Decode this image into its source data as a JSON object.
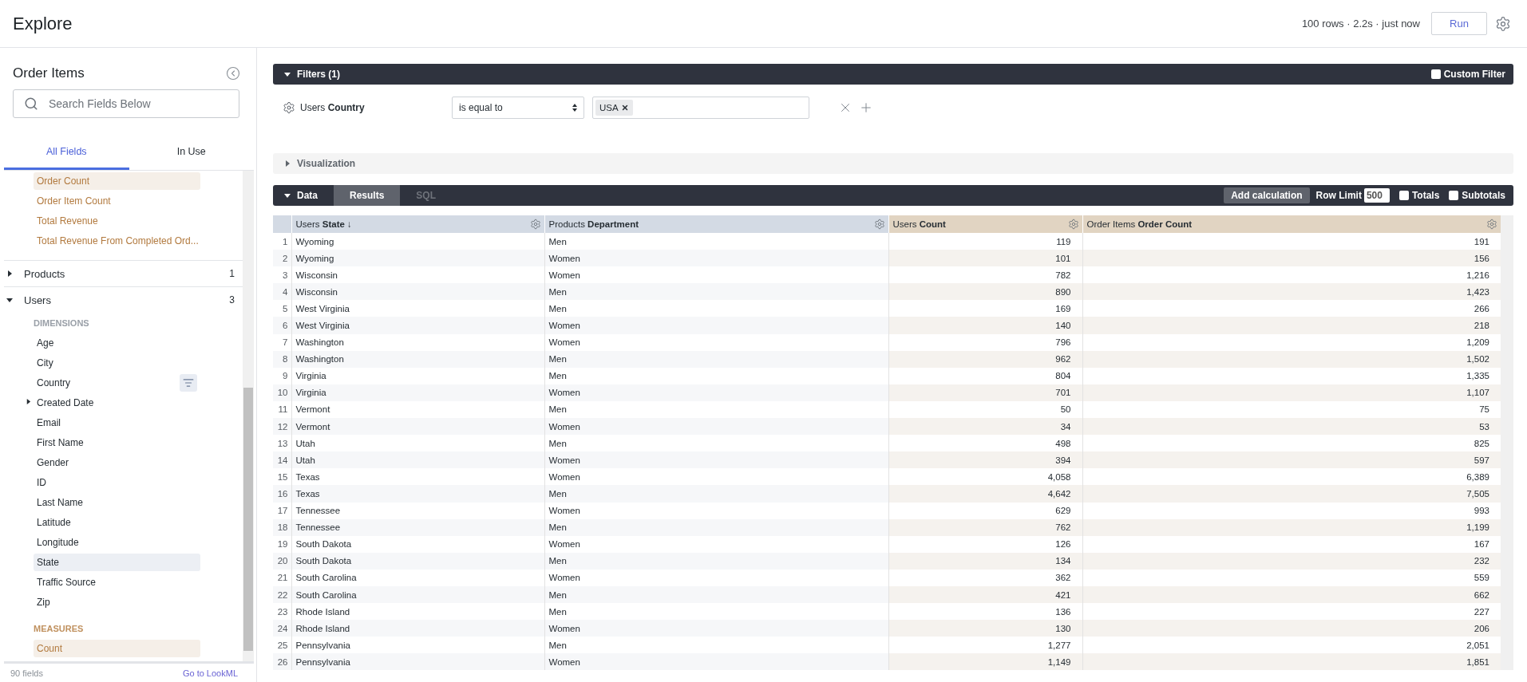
{
  "header": {
    "title": "Explore",
    "status": "100 rows · 2.2s · just now",
    "run_button": "Run"
  },
  "sidebar": {
    "title": "Order Items",
    "search_placeholder": "Search Fields Below",
    "tabs": [
      {
        "label": "All Fields",
        "selected": true
      },
      {
        "label": "In Use",
        "selected": false
      }
    ],
    "field_list": [
      {
        "kind": "measure_field",
        "label": "Order Count",
        "selected": true,
        "filtered": false,
        "expandable": false
      },
      {
        "kind": "measure_field",
        "label": "Order Item Count",
        "selected": false,
        "filtered": false,
        "expandable": false
      },
      {
        "kind": "measure_field",
        "label": "Total Revenue",
        "selected": false,
        "filtered": false,
        "expandable": false
      },
      {
        "kind": "measure_field",
        "label": "Total Revenue From Completed Ord...",
        "selected": false,
        "filtered": false,
        "expandable": false
      },
      {
        "kind": "group",
        "label": "Products",
        "count": "1",
        "expanded": false
      },
      {
        "kind": "group",
        "label": "Users",
        "count": "3",
        "expanded": true
      },
      {
        "kind": "dimensions_label",
        "label": "DIMENSIONS"
      },
      {
        "kind": "dimension_field",
        "label": "Age",
        "selected": false,
        "filtered": false,
        "expandable": false
      },
      {
        "kind": "dimension_field",
        "label": "City",
        "selected": false,
        "filtered": false,
        "expandable": false
      },
      {
        "kind": "dimension_field",
        "label": "Country",
        "selected": false,
        "filtered": true,
        "expandable": false
      },
      {
        "kind": "dimension_field",
        "label": "Created Date",
        "selected": false,
        "filtered": false,
        "expandable": true
      },
      {
        "kind": "dimension_field",
        "label": "Email",
        "selected": false,
        "filtered": false,
        "expandable": false
      },
      {
        "kind": "dimension_field",
        "label": "First Name",
        "selected": false,
        "filtered": false,
        "expandable": false
      },
      {
        "kind": "dimension_field",
        "label": "Gender",
        "selected": false,
        "filtered": false,
        "expandable": false
      },
      {
        "kind": "dimension_field",
        "label": "ID",
        "selected": false,
        "filtered": false,
        "expandable": false
      },
      {
        "kind": "dimension_field",
        "label": "Last Name",
        "selected": false,
        "filtered": false,
        "expandable": false
      },
      {
        "kind": "dimension_field",
        "label": "Latitude",
        "selected": false,
        "filtered": false,
        "expandable": false
      },
      {
        "kind": "dimension_field",
        "label": "Longitude",
        "selected": false,
        "filtered": false,
        "expandable": false
      },
      {
        "kind": "dimension_field",
        "label": "State",
        "selected": true,
        "filtered": false,
        "expandable": false
      },
      {
        "kind": "dimension_field",
        "label": "Traffic Source",
        "selected": false,
        "filtered": false,
        "expandable": false
      },
      {
        "kind": "dimension_field",
        "label": "Zip",
        "selected": false,
        "filtered": false,
        "expandable": false
      },
      {
        "kind": "measures_label",
        "label": "MEASURES"
      },
      {
        "kind": "measure_field",
        "label": "Count",
        "selected": true,
        "filtered": false,
        "expandable": false
      }
    ],
    "footer": {
      "count": "90 fields",
      "link": "Go to LookML"
    }
  },
  "filters": {
    "title": "Filters (1)",
    "expanded": true,
    "custom_filter": {
      "label": "Custom Filter",
      "checked": false
    },
    "rows": [
      {
        "field": "Users **Country**",
        "operator": "is equal to",
        "values": [
          "USA"
        ]
      }
    ]
  },
  "visualization": {
    "title": "Visualization",
    "expanded": false
  },
  "data": {
    "title": "Data",
    "expanded": true,
    "tabs": [
      {
        "label": "Results",
        "selected": true
      },
      {
        "label": "SQL",
        "selected": false
      }
    ],
    "add_calculation": "Add calculation",
    "row_limit": {
      "label": "Row Limit",
      "value": "500"
    },
    "totals": {
      "label": "Totals",
      "checked": false
    },
    "subtotals": {
      "label": "Subtotals",
      "checked": false
    },
    "table": {
      "columns": [
        {
          "label": "Users **State** ↓",
          "kind": "dimension"
        },
        {
          "label": "Products **Department**",
          "kind": "dimension"
        },
        {
          "label": "Users **Count**",
          "kind": "measure"
        },
        {
          "label": "Order Items **Order Count**",
          "kind": "measure"
        }
      ],
      "rows": [
        {
          "number": "1",
          "cells": [
            "Wyoming",
            "Men",
            "119",
            "191"
          ]
        },
        {
          "number": "2",
          "cells": [
            "Wyoming",
            "Women",
            "101",
            "156"
          ]
        },
        {
          "number": "3",
          "cells": [
            "Wisconsin",
            "Women",
            "782",
            "1,216"
          ]
        },
        {
          "number": "4",
          "cells": [
            "Wisconsin",
            "Men",
            "890",
            "1,423"
          ]
        },
        {
          "number": "5",
          "cells": [
            "West Virginia",
            "Men",
            "169",
            "266"
          ]
        },
        {
          "number": "6",
          "cells": [
            "West Virginia",
            "Women",
            "140",
            "218"
          ]
        },
        {
          "number": "7",
          "cells": [
            "Washington",
            "Women",
            "796",
            "1,209"
          ]
        },
        {
          "number": "8",
          "cells": [
            "Washington",
            "Men",
            "962",
            "1,502"
          ]
        },
        {
          "number": "9",
          "cells": [
            "Virginia",
            "Men",
            "804",
            "1,335"
          ]
        },
        {
          "number": "10",
          "cells": [
            "Virginia",
            "Women",
            "701",
            "1,107"
          ]
        },
        {
          "number": "11",
          "cells": [
            "Vermont",
            "Men",
            "50",
            "75"
          ]
        },
        {
          "number": "12",
          "cells": [
            "Vermont",
            "Women",
            "34",
            "53"
          ]
        },
        {
          "number": "13",
          "cells": [
            "Utah",
            "Men",
            "498",
            "825"
          ]
        },
        {
          "number": "14",
          "cells": [
            "Utah",
            "Women",
            "394",
            "597"
          ]
        },
        {
          "number": "15",
          "cells": [
            "Texas",
            "Women",
            "4,058",
            "6,389"
          ]
        },
        {
          "number": "16",
          "cells": [
            "Texas",
            "Men",
            "4,642",
            "7,505"
          ]
        },
        {
          "number": "17",
          "cells": [
            "Tennessee",
            "Women",
            "629",
            "993"
          ]
        },
        {
          "number": "18",
          "cells": [
            "Tennessee",
            "Men",
            "762",
            "1,199"
          ]
        },
        {
          "number": "19",
          "cells": [
            "South Dakota",
            "Women",
            "126",
            "167"
          ]
        },
        {
          "number": "20",
          "cells": [
            "South Dakota",
            "Men",
            "134",
            "232"
          ]
        },
        {
          "number": "21",
          "cells": [
            "South Carolina",
            "Women",
            "362",
            "559"
          ]
        },
        {
          "number": "22",
          "cells": [
            "South Carolina",
            "Men",
            "421",
            "662"
          ]
        },
        {
          "number": "23",
          "cells": [
            "Rhode Island",
            "Men",
            "136",
            "227"
          ]
        },
        {
          "number": "24",
          "cells": [
            "Rhode Island",
            "Women",
            "130",
            "206"
          ]
        },
        {
          "number": "25",
          "cells": [
            "Pennsylvania",
            "Men",
            "1,277",
            "2,051"
          ]
        },
        {
          "number": "26",
          "cells": [
            "Pennsylvania",
            "Women",
            "1,149",
            "1,851"
          ]
        }
      ]
    }
  }
}
